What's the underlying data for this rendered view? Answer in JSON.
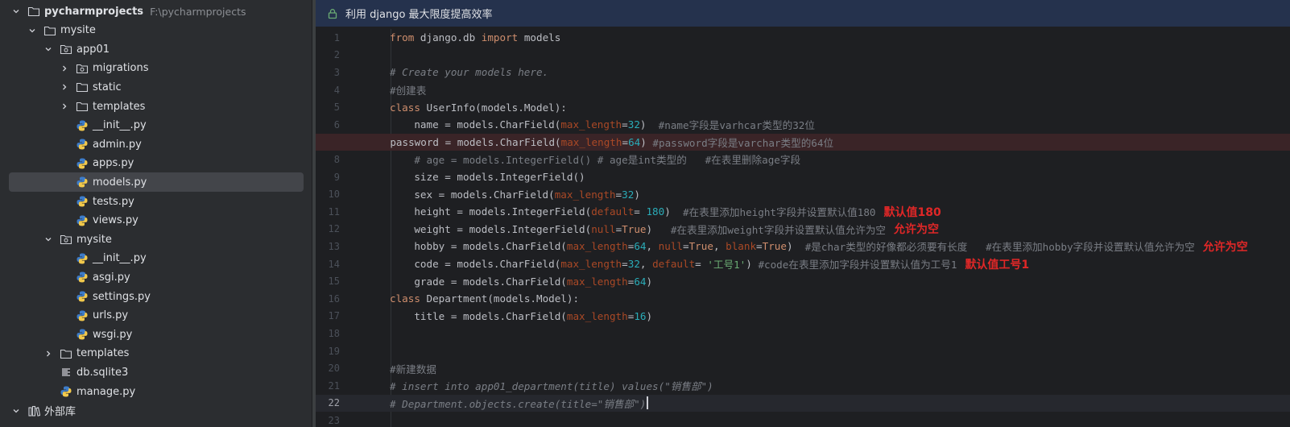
{
  "project_tree": {
    "root": {
      "name": "pycharmprojects",
      "path": "F:\\pycharmprojects"
    },
    "items": [
      {
        "label": "pycharmprojects",
        "type": "folder-open",
        "depth": 0,
        "expanded": true
      },
      {
        "label": "mysite",
        "type": "folder",
        "depth": 1,
        "expanded": true
      },
      {
        "label": "app01",
        "type": "package",
        "depth": 2,
        "expanded": true
      },
      {
        "label": "migrations",
        "type": "package",
        "depth": 3,
        "expanded": false
      },
      {
        "label": "static",
        "type": "folder",
        "depth": 3,
        "expanded": false
      },
      {
        "label": "templates",
        "type": "folder",
        "depth": 3,
        "expanded": false
      },
      {
        "label": "__init__.py",
        "type": "python",
        "depth": 3
      },
      {
        "label": "admin.py",
        "type": "python",
        "depth": 3
      },
      {
        "label": "apps.py",
        "type": "python",
        "depth": 3
      },
      {
        "label": "models.py",
        "type": "python",
        "depth": 3,
        "selected": true
      },
      {
        "label": "tests.py",
        "type": "python",
        "depth": 3
      },
      {
        "label": "views.py",
        "type": "python",
        "depth": 3
      },
      {
        "label": "mysite",
        "type": "package",
        "depth": 2,
        "expanded": true
      },
      {
        "label": "__init__.py",
        "type": "python",
        "depth": 3
      },
      {
        "label": "asgi.py",
        "type": "python",
        "depth": 3
      },
      {
        "label": "settings.py",
        "type": "python",
        "depth": 3
      },
      {
        "label": "urls.py",
        "type": "python",
        "depth": 3
      },
      {
        "label": "wsgi.py",
        "type": "python",
        "depth": 3
      },
      {
        "label": "templates",
        "type": "folder",
        "depth": 2,
        "expanded": false
      },
      {
        "label": "db.sqlite3",
        "type": "db",
        "depth": 2
      },
      {
        "label": "manage.py",
        "type": "python",
        "depth": 2
      },
      {
        "label": "外部库",
        "type": "library",
        "depth": 0,
        "expanded": true
      }
    ]
  },
  "editor": {
    "banner": "利用 django 最大限度提高效率",
    "breakpoint_line": 7,
    "current_line": 22,
    "lines": [
      {
        "n": "1",
        "tokens": [
          [
            "k",
            "from"
          ],
          [
            "t",
            " django.db "
          ],
          [
            "k",
            "import"
          ],
          [
            "t",
            " models"
          ]
        ]
      },
      {
        "n": "2",
        "tokens": []
      },
      {
        "n": "3",
        "tokens": [
          [
            "c",
            "# Create your models here."
          ]
        ]
      },
      {
        "n": "4",
        "tokens": [
          [
            "cz",
            "#创建表"
          ]
        ]
      },
      {
        "n": "5",
        "tokens": [
          [
            "k",
            "class"
          ],
          [
            "t",
            " UserInfo(models.Model):"
          ]
        ]
      },
      {
        "n": "6",
        "tokens": [
          [
            "t",
            "    name = models.CharField("
          ],
          [
            "p",
            "max_length"
          ],
          [
            "t",
            "="
          ],
          [
            "n",
            "32"
          ],
          [
            "t",
            ")  "
          ],
          [
            "cz",
            "#name字段是varhcar类型的32位"
          ]
        ]
      },
      {
        "n": "7",
        "tokens": [
          [
            "t",
            "    password = models.CharField("
          ],
          [
            "p",
            "max_length"
          ],
          [
            "t",
            "="
          ],
          [
            "n",
            "64"
          ],
          [
            "t",
            ") "
          ],
          [
            "cz",
            "#password字段是varchar类型的64位"
          ]
        ]
      },
      {
        "n": "8",
        "tokens": [
          [
            "cz",
            "    # age = models.IntegerField() # age是int类型的   #在表里删除age字段"
          ]
        ]
      },
      {
        "n": "9",
        "tokens": [
          [
            "t",
            "    size = models.IntegerField()"
          ]
        ]
      },
      {
        "n": "10",
        "tokens": [
          [
            "t",
            "    sex = models.CharField("
          ],
          [
            "p",
            "max_length"
          ],
          [
            "t",
            "="
          ],
          [
            "n",
            "32"
          ],
          [
            "t",
            ")"
          ]
        ]
      },
      {
        "n": "11",
        "tokens": [
          [
            "t",
            "    height = models.IntegerField("
          ],
          [
            "p",
            "default"
          ],
          [
            "t",
            "= "
          ],
          [
            "n",
            "180"
          ],
          [
            "t",
            ")  "
          ],
          [
            "cz",
            "#在表里添加height字段并设置默认值180"
          ],
          [
            "a",
            "默认值180"
          ]
        ]
      },
      {
        "n": "12",
        "tokens": [
          [
            "t",
            "    weight = models.IntegerField("
          ],
          [
            "p",
            "null"
          ],
          [
            "t",
            "="
          ],
          [
            "k",
            "True"
          ],
          [
            "t",
            ")   "
          ],
          [
            "cz",
            "#在表里添加weight字段并设置默认值允许为空"
          ],
          [
            "a",
            "允许为空"
          ]
        ]
      },
      {
        "n": "13",
        "tokens": [
          [
            "t",
            "    hobby = models.CharField("
          ],
          [
            "p",
            "max_length"
          ],
          [
            "t",
            "="
          ],
          [
            "n",
            "64"
          ],
          [
            "t",
            ", "
          ],
          [
            "p",
            "null"
          ],
          [
            "t",
            "="
          ],
          [
            "k",
            "True"
          ],
          [
            "t",
            ", "
          ],
          [
            "p",
            "blank"
          ],
          [
            "t",
            "="
          ],
          [
            "k",
            "True"
          ],
          [
            "t",
            ")  "
          ],
          [
            "cz",
            "#是char类型的好像都必须要有长度   #在表里添加hobby字段并设置默认值允许为空"
          ],
          [
            "a",
            "允许为空"
          ]
        ]
      },
      {
        "n": "14",
        "tokens": [
          [
            "t",
            "    code = models.CharField("
          ],
          [
            "p",
            "max_length"
          ],
          [
            "t",
            "="
          ],
          [
            "n",
            "32"
          ],
          [
            "t",
            ", "
          ],
          [
            "p",
            "default"
          ],
          [
            "t",
            "= "
          ],
          [
            "s",
            "'工号1'"
          ],
          [
            "t",
            ") "
          ],
          [
            "cz",
            "#code在表里添加字段并设置默认值为工号1"
          ],
          [
            "a",
            "默认值工号1"
          ]
        ]
      },
      {
        "n": "15",
        "tokens": [
          [
            "t",
            "    grade = models.CharField("
          ],
          [
            "p",
            "max_length"
          ],
          [
            "t",
            "="
          ],
          [
            "n",
            "64"
          ],
          [
            "t",
            ")"
          ]
        ]
      },
      {
        "n": "16",
        "tokens": [
          [
            "k",
            "class"
          ],
          [
            "t",
            " Department(models.Model):"
          ]
        ]
      },
      {
        "n": "17",
        "tokens": [
          [
            "t",
            "    title = models.CharField("
          ],
          [
            "p",
            "max_length"
          ],
          [
            "t",
            "="
          ],
          [
            "n",
            "16"
          ],
          [
            "t",
            ")"
          ]
        ]
      },
      {
        "n": "18",
        "tokens": []
      },
      {
        "n": "19",
        "tokens": []
      },
      {
        "n": "20",
        "tokens": [
          [
            "cz",
            "#新建数据"
          ]
        ]
      },
      {
        "n": "21",
        "tokens": [
          [
            "c",
            "# insert into app01_department(title) values(\"销售部\")"
          ]
        ]
      },
      {
        "n": "22",
        "tokens": [
          [
            "c",
            "# Department.objects.create(title=\"销售部\")"
          ]
        ]
      },
      {
        "n": "23",
        "tokens": []
      }
    ]
  },
  "colors": {
    "keyword": "#cf8e6d",
    "comment": "#7a7e85",
    "param": "#aa4926",
    "number": "#2aacb8",
    "string": "#6aab73",
    "annotation": "#e02727",
    "breakpoint": "#db5c5c"
  }
}
